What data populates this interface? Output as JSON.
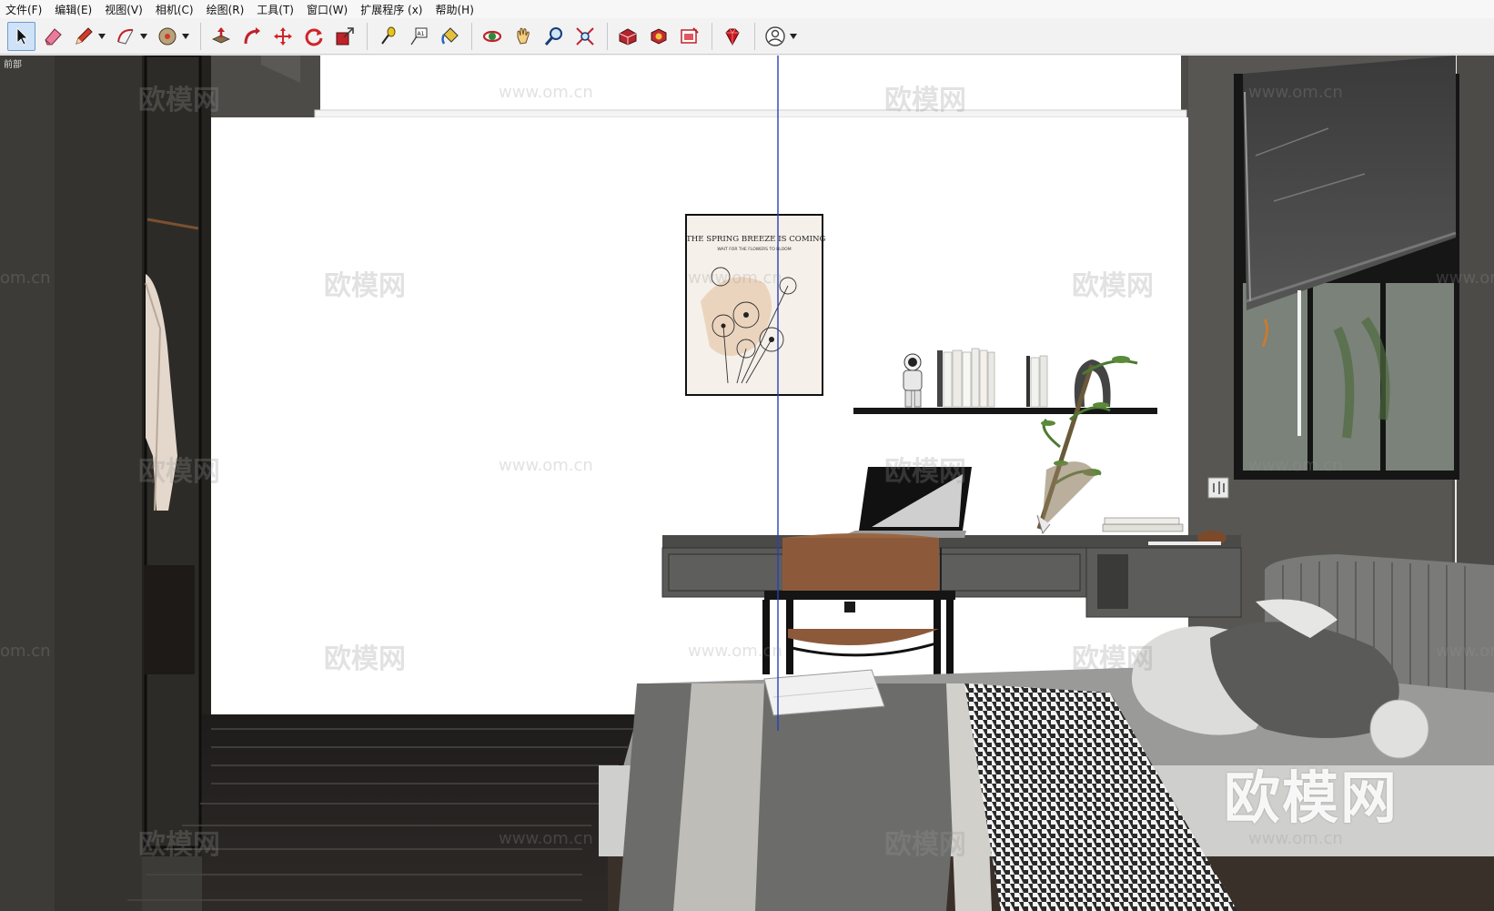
{
  "menu": {
    "items": [
      "文件(F)",
      "编辑(E)",
      "视图(V)",
      "相机(C)",
      "绘图(R)",
      "工具(T)",
      "窗口(W)",
      "扩展程序 (x)",
      "帮助(H)"
    ]
  },
  "toolbar": {
    "tools": [
      {
        "icon": "select-arrow-icon",
        "active": true
      },
      {
        "icon": "eraser-icon"
      },
      {
        "icon": "pencil-icon",
        "dropdown": true
      },
      {
        "icon": "arc-icon",
        "dropdown": true
      },
      {
        "icon": "circle-shape-icon",
        "dropdown": true
      },
      {
        "icon": "push-pull-icon"
      },
      {
        "icon": "follow-me-icon"
      },
      {
        "icon": "move-icon"
      },
      {
        "icon": "rotate-icon"
      },
      {
        "icon": "scale-icon"
      },
      {
        "icon": "tape-measure-icon"
      },
      {
        "icon": "text-label-icon"
      },
      {
        "icon": "paint-bucket-icon"
      },
      {
        "icon": "orbit-icon"
      },
      {
        "icon": "pan-hand-icon"
      },
      {
        "icon": "zoom-icon"
      },
      {
        "icon": "zoom-extents-icon"
      },
      {
        "icon": "warehouse-icon"
      },
      {
        "icon": "extension-warehouse-icon"
      },
      {
        "icon": "layout-icon"
      },
      {
        "icon": "ruby-gem-icon"
      },
      {
        "icon": "account-icon",
        "dropdown": true
      }
    ]
  },
  "viewport": {
    "view_label": "前部",
    "poster": {
      "title": "THE SPRING BREEZE IS COMING",
      "subtitle": "WAIT FOR THE FLOWERS TO BLOOM"
    },
    "watermark": {
      "brand": "欧模网",
      "url": "www.om.cn",
      "partial": "om.cn"
    }
  },
  "colors": {
    "selection_border": "#6d9ccf",
    "selection_fill": "#cfe2f7",
    "wall_white": "#ffffff",
    "wall_dark": "#4a4a48",
    "axis_blue": "#2b3fb8"
  }
}
